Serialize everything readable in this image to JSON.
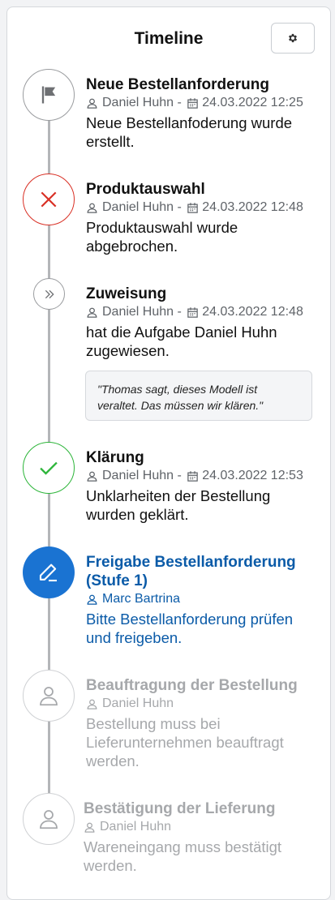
{
  "header": {
    "title": "Timeline",
    "settings_icon": "gear-icon"
  },
  "colors": {
    "accent": "#1a73d2",
    "error": "#d93025",
    "success": "#2db53a",
    "pending": "#a6a8ab",
    "line": "#b4b6b9"
  },
  "entries": [
    {
      "title": "Neue Bestellanforderung",
      "user": "Daniel Huhn",
      "sep": " - ",
      "date": "24.03.2022 12:25",
      "desc": "Neue Bestellanfoderung wurde erstellt.",
      "icon": "flag-icon",
      "state": "done"
    },
    {
      "title": "Produktauswahl",
      "user": "Daniel Huhn",
      "sep": " - ",
      "date": "24.03.2022 12:48",
      "desc": "Produktauswahl wurde abgebrochen.",
      "icon": "close-icon",
      "state": "cancelled"
    },
    {
      "title": "Zuweisung",
      "user": "Daniel Huhn",
      "sep": " - ",
      "date": "24.03.2022 12:48",
      "desc": "hat die Aufgabe Daniel Huhn zugewiesen.",
      "comment": "\"Thomas sagt, dieses Modell ist veraltet. Das müssen wir klären.\"",
      "icon": "chevron-double-right-icon",
      "state": "forwarded"
    },
    {
      "title": "Klärung",
      "user": "Daniel Huhn",
      "sep": " - ",
      "date": "24.03.2022 12:53",
      "desc": "Unklarheiten der Bestellung wurden geklärt.",
      "icon": "check-icon",
      "state": "done"
    },
    {
      "title": "Freigabe Bestellanforderung (Stufe 1)",
      "user": "Marc Bartrina",
      "desc": "Bitte Bestellanforderung prüfen und freigeben.",
      "icon": "edit-icon",
      "state": "active"
    },
    {
      "title": "Beauftragung der Bestellung",
      "user": "Daniel Huhn",
      "desc": "Bestellung muss bei Lieferunternehmen beauftragt werden.",
      "icon": "person-icon",
      "state": "pending"
    },
    {
      "title": "Bestätigung der Lieferung",
      "user": "Daniel Huhn",
      "desc": "Wareneingang muss bestätigt werden.",
      "icon": "person-icon",
      "state": "pending"
    }
  ]
}
